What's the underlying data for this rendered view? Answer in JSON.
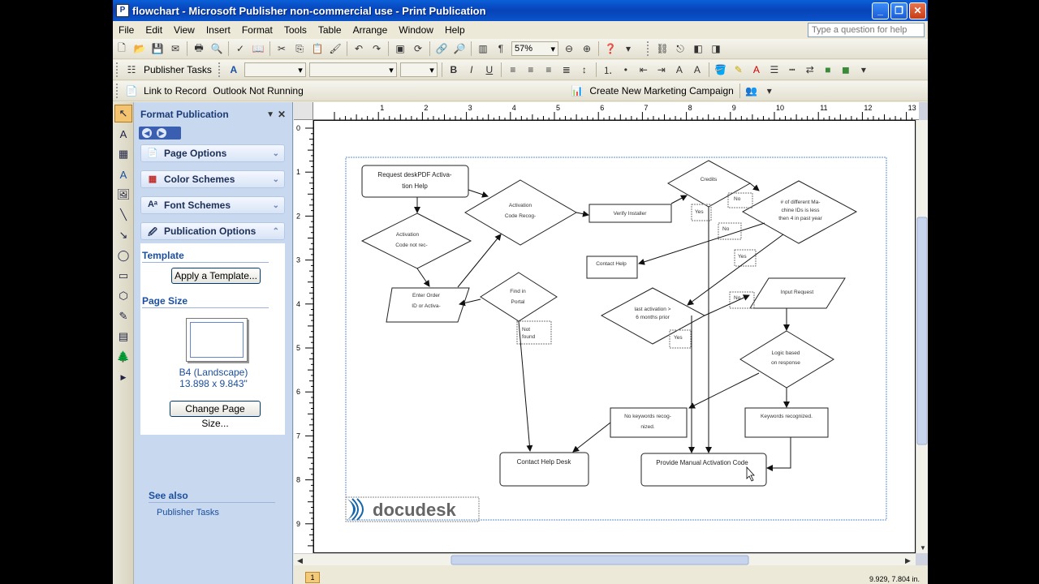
{
  "window": {
    "title": "flowchart - Microsoft Publisher non-commercial use - Print Publication",
    "icon": "P"
  },
  "menu": {
    "items": [
      "File",
      "Edit",
      "View",
      "Insert",
      "Format",
      "Tools",
      "Table",
      "Arrange",
      "Window",
      "Help"
    ],
    "ask_placeholder": "Type a question for help"
  },
  "toolbar": {
    "zoom": "57%",
    "publisher_tasks": "Publisher Tasks",
    "link_to_record": "Link to Record",
    "outlook_status": "Outlook Not Running",
    "marketing_campaign": "Create New Marketing Campaign"
  },
  "taskpane": {
    "title": "Format Publication",
    "sections": [
      "Page Options",
      "Color Schemes",
      "Font Schemes",
      "Publication Options"
    ],
    "template_title": "Template",
    "apply_template": "Apply a Template...",
    "page_size_title": "Page Size",
    "page_size_name": "B4 (Landscape)",
    "page_size_dims": "13.898 x 9.843\"",
    "change_page_size": "Change Page Size...",
    "see_also": "See also",
    "see_also_link": "Publisher Tasks"
  },
  "rulers": {
    "top_marks": [
      "1",
      "2",
      "3",
      "4",
      "5",
      "6",
      "7",
      "8",
      "9",
      "10",
      "11",
      "12",
      "13"
    ],
    "left_marks": [
      "0",
      "1",
      "2",
      "3",
      "4",
      "5",
      "6",
      "7",
      "8",
      "9"
    ]
  },
  "flowchart": {
    "request": [
      "Request deskPDF Activa-",
      "tion Help"
    ],
    "code_not_rec": [
      "Activation",
      "Code not rec-"
    ],
    "activation_code_recog": [
      "Activation",
      "Code Recog-"
    ],
    "verify_installer": "Verify Installer",
    "credits": "Credits",
    "machine_ids": [
      "# of different Ma-",
      "chine IDs is less",
      "then 4 in past year"
    ],
    "contact_help": "Contact Help",
    "enter_order": [
      "Enter Order",
      "ID or Activa-"
    ],
    "find_in_portal": [
      "Find in",
      "Portal"
    ],
    "not_found": [
      "Not",
      "found"
    ],
    "last_activation": [
      "last activation >",
      "6 months prior"
    ],
    "input_request": "Input Request",
    "logic_based": [
      "Logic based",
      "on response"
    ],
    "no_keywords": [
      "No keywords recog-",
      "nized."
    ],
    "keywords_recognized": "Keywords recognized.",
    "contact_help_desk": "Contact Help Desk",
    "provide_manual": "Provide Manual Activation Code",
    "labels": {
      "no": "No",
      "yes": "Yes"
    },
    "logo": "docudesk"
  },
  "status": {
    "page_number": "1",
    "coords": "9.929, 7.804 in."
  }
}
